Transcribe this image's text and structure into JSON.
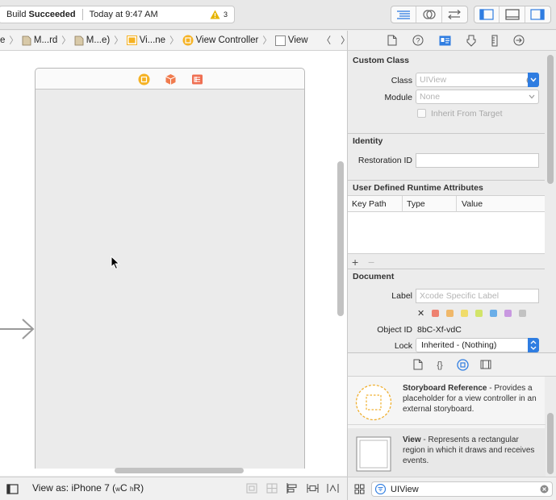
{
  "toolbar": {
    "status": {
      "prefix": "Build ",
      "state": "Succeeded",
      "time": "Today at 9:47 AM",
      "warning_count": "3"
    }
  },
  "jumpbar": {
    "crumbs": [
      {
        "label": "e",
        "icon": "chevron-icon"
      },
      {
        "label": "M...rd",
        "icon": "folder-icon"
      },
      {
        "label": "M...e)",
        "icon": "folder-icon"
      },
      {
        "label": "Vi...ne",
        "icon": "scene-icon"
      },
      {
        "label": "View Controller",
        "icon": "view-controller-icon"
      },
      {
        "label": "View",
        "icon": "view-icon"
      }
    ]
  },
  "bottombar": {
    "view_as_prefix": "View as: iPhone 7 (",
    "wC": "wC",
    "hR": "hR",
    "view_as_suffix": ")"
  },
  "inspector": {
    "custom_class": {
      "title": "Custom Class",
      "class_label": "Class",
      "class_placeholder": "UIView",
      "module_label": "Module",
      "module_placeholder": "None",
      "inherit_label": "Inherit From Target"
    },
    "identity": {
      "title": "Identity",
      "restoration_label": "Restoration ID",
      "restoration_value": ""
    },
    "runtime_attrs": {
      "title": "User Defined Runtime Attributes",
      "columns": [
        "Key Path",
        "Type",
        "Value"
      ],
      "add": "+",
      "remove": "−"
    },
    "document": {
      "title": "Document",
      "label_label": "Label",
      "label_placeholder": "Xcode Specific Label",
      "colors": [
        "#ee8170",
        "#f0b86a",
        "#f0dc6a",
        "#d2e46a",
        "#6aaee8",
        "#c898e0",
        "#c2c2c2"
      ],
      "object_id_label": "Object ID",
      "object_id_value": "8bC-Xf-vdC",
      "lock_label": "Lock",
      "lock_value": "Inherited - (Nothing)"
    }
  },
  "library": {
    "items": [
      {
        "name": "Storyboard Reference",
        "desc": " - Provides a placeholder for a view controller in an external storyboard."
      },
      {
        "name": "View",
        "desc": " - Represents a rectangular region in which it draws and receives events."
      }
    ],
    "filter_value": "UIView"
  },
  "colors": {
    "accent": "#2f7de1",
    "warning": "#e6b400",
    "scene_icon": "#f5b223",
    "first_responder": "#f07b4e",
    "exit": "#ef6f52"
  }
}
